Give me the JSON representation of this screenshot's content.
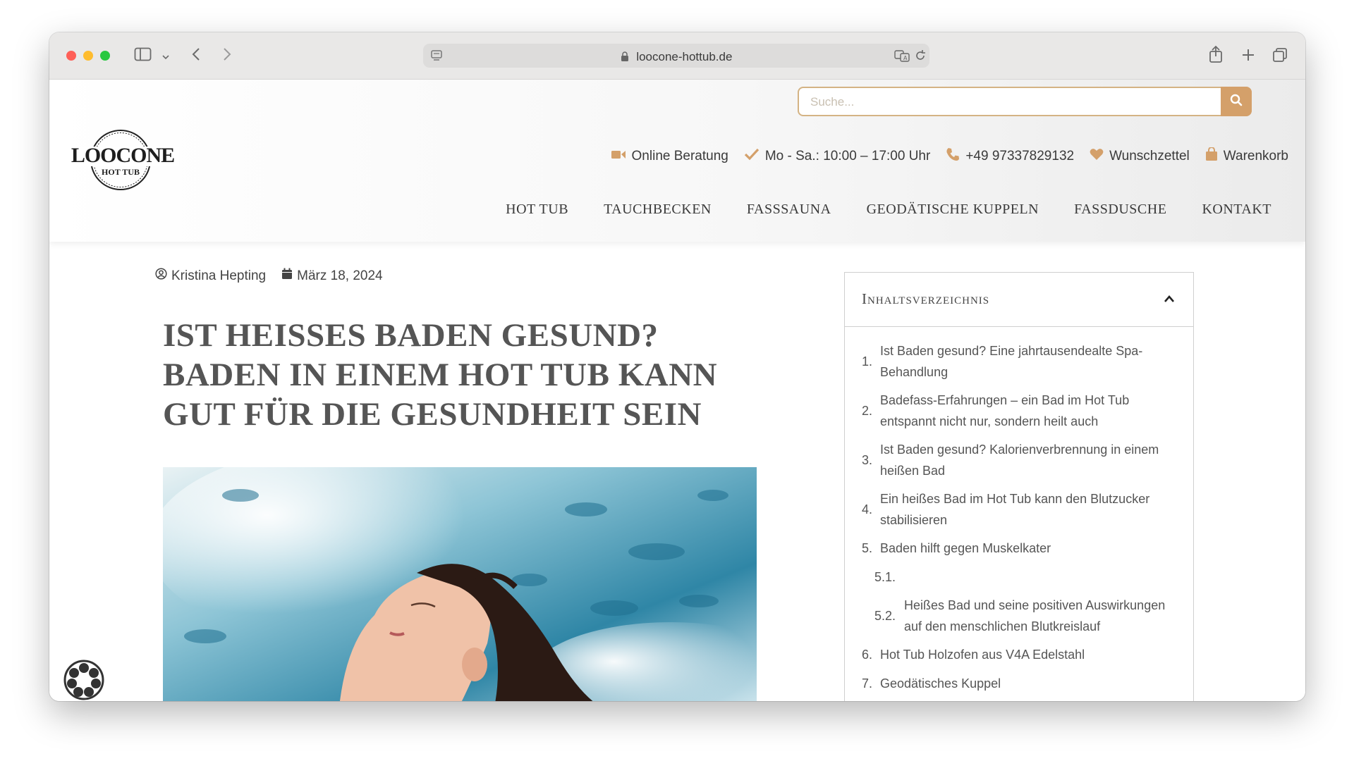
{
  "browser": {
    "url": "loocone-hottub.de"
  },
  "header": {
    "search_placeholder": "Suche...",
    "logo_text_main": "LOOCONE",
    "logo_text_sub": "HOT TUB",
    "info": {
      "consult": "Online Beratung",
      "hours": "Mo - Sa.: 10:00 – 17:00 Uhr",
      "phone": "+49 97337829132",
      "wishlist": "Wunschzettel",
      "cart": "Warenkorb"
    },
    "nav": [
      "HOT TUB",
      "TAUCHBECKEN",
      "FASSSAUNA",
      "GEODÄTISCHE KUPPELN",
      "FASSDUSCHE",
      "KONTAKT"
    ]
  },
  "article": {
    "author": "Kristina Hepting",
    "date": "März 18, 2024",
    "title": "IST HEISSES BADEN GESUND? BADEN IN EINEM HOT TUB KANN GUT FÜR DIE GESUNDHEIT SEIN"
  },
  "toc": {
    "title": "Inhaltsverzeichnis",
    "items": [
      {
        "num": "1.",
        "text": "Ist Baden gesund? Eine jahrtausendealte Spa-Behandlung"
      },
      {
        "num": "2.",
        "text": "Badefass-Erfahrungen – ein Bad im Hot Tub entspannt nicht nur, sondern heilt auch"
      },
      {
        "num": "3.",
        "text": "Ist Baden gesund? Kalorienverbrennung in einem heißen Bad"
      },
      {
        "num": "4.",
        "text": "Ein heißes Bad im Hot Tub kann den Blutzucker stabilisieren"
      },
      {
        "num": "5.",
        "text": "Baden hilft gegen Muskelkater"
      },
      {
        "num": "5.1.",
        "text": ""
      },
      {
        "num": "5.2.",
        "text": "Heißes Bad und seine positiven Auswirkungen auf den menschlichen Blutkreislauf"
      },
      {
        "num": "6.",
        "text": "Hot Tub Holzofen aus V4A Edelstahl"
      },
      {
        "num": "7.",
        "text": "Geodätisches Kuppel"
      }
    ]
  },
  "colors": {
    "accent": "#d4a06a",
    "border_accent": "#d4b384"
  }
}
